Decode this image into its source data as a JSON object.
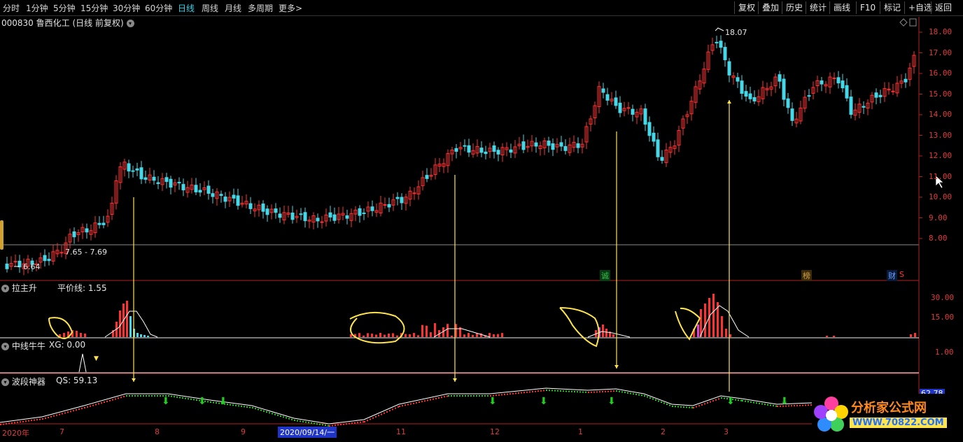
{
  "top_menu": {
    "periods": [
      "分时",
      "1分钟",
      "5分钟",
      "15分钟",
      "30分钟",
      "60分钟",
      "日线",
      "周线",
      "月线",
      "多周期",
      "更多"
    ],
    "active_period": "日线",
    "more_arrow": ">",
    "right_buttons": [
      "复权",
      "叠加",
      "历史",
      "统计",
      "画线",
      "F10",
      "标记",
      "+自选",
      "返回"
    ]
  },
  "stock": {
    "code": "000830",
    "name": "鲁西化工",
    "mode": "(日线 前复权)"
  },
  "main_chart": {
    "price_axis": [
      "18.00",
      "17.00",
      "16.00",
      "15.00",
      "14.00",
      "13.00",
      "12.00",
      "11.00",
      "10.00",
      "9.00",
      "8.00"
    ],
    "high_marker": "18.07",
    "low_marker": "6.64",
    "range_label": "7.65 - 7.69",
    "badges": [
      {
        "text": "诚",
        "color": "#2fbf4a"
      },
      {
        "text": "榜",
        "color": "#d0a040"
      },
      {
        "text": "财",
        "color": "#6aa0ff"
      },
      {
        "text": "S",
        "color": "#ff3030"
      }
    ]
  },
  "panels": [
    {
      "name": "拉主升",
      "value_label": "平价线: 1.55",
      "axis": [
        "30.00",
        "15.00"
      ]
    },
    {
      "name": "中线牛牛",
      "value_label": "XG: 0.00",
      "axis": [
        "1.00"
      ]
    },
    {
      "name": "波段神器",
      "value_label": "QS: 59.13",
      "axis_tag": "62.78"
    }
  ],
  "dates": [
    "2020年",
    "7",
    "8",
    "9",
    "11",
    "12",
    "1",
    "2",
    "3"
  ],
  "selected_date": "2020/09/14/一",
  "watermark": "分析家公式网www.70822.Com",
  "logo": {
    "title": "分析家公式网",
    "url": "WWW.70822.COM"
  },
  "colors": {
    "up": "#ff3232",
    "down": "#44d8e8",
    "active": "#2fd3e8",
    "signal": "#ffe34a",
    "green": "#1fd01f"
  }
}
